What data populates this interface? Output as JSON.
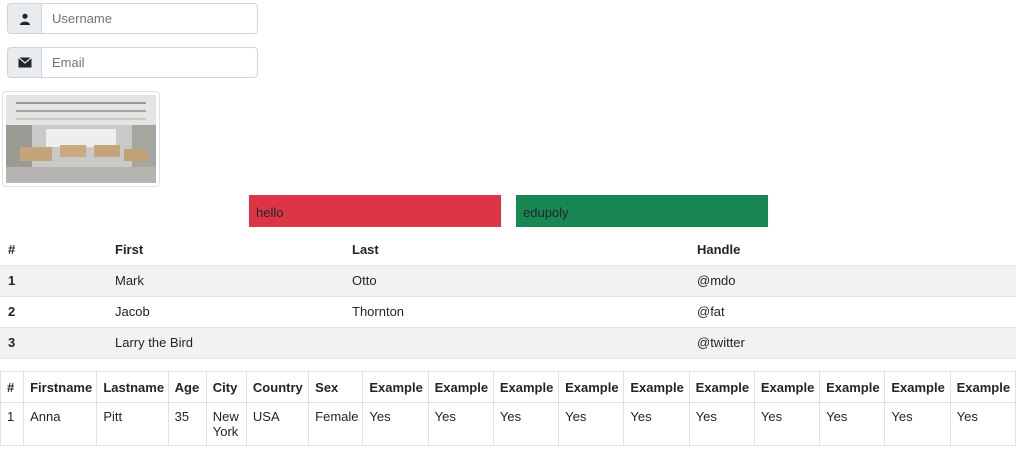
{
  "form": {
    "username": {
      "placeholder": "Username",
      "icon": "user-icon"
    },
    "email": {
      "placeholder": "Email",
      "icon": "envelope-icon"
    }
  },
  "image": {
    "alt": "office interior"
  },
  "boxes": {
    "hello": {
      "label": "hello",
      "color": "#dc3545"
    },
    "edupoly": {
      "label": "edupoly",
      "color": "#198754"
    }
  },
  "striped_table": {
    "headers": [
      "#",
      "First",
      "Last",
      "Handle"
    ],
    "rows": [
      [
        "1",
        "Mark",
        "Otto",
        "@mdo"
      ],
      [
        "2",
        "Jacob",
        "Thornton",
        "@fat"
      ],
      [
        "3",
        "Larry the Bird",
        "",
        "@twitter"
      ]
    ]
  },
  "bordered_table": {
    "headers": [
      "#",
      "Firstname",
      "Lastname",
      "Age",
      "City",
      "Country",
      "Sex",
      "Example",
      "Example",
      "Example",
      "Example",
      "Example",
      "Example",
      "Example",
      "Example",
      "Example",
      "Example"
    ],
    "rows": [
      [
        "1",
        "Anna",
        "Pitt",
        "35",
        "New York",
        "USA",
        "Female",
        "Yes",
        "Yes",
        "Yes",
        "Yes",
        "Yes",
        "Yes",
        "Yes",
        "Yes",
        "Yes",
        "Yes"
      ]
    ]
  }
}
